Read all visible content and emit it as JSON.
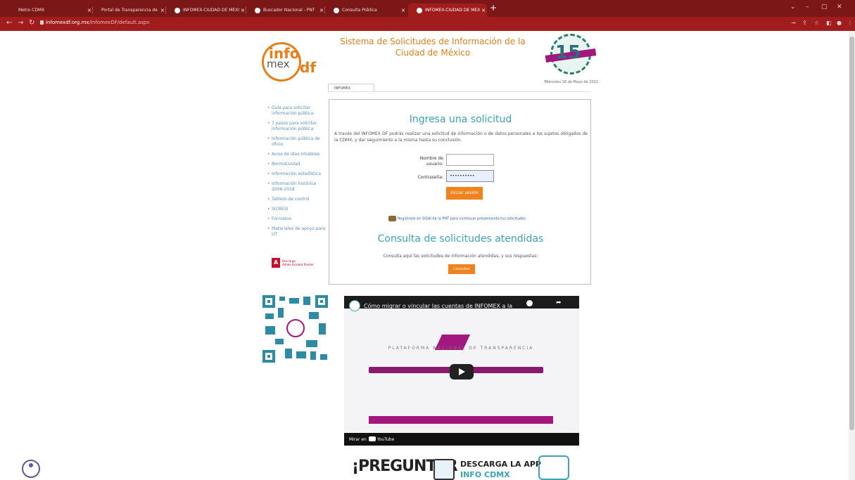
{
  "browser": {
    "tabs": [
      {
        "label": "Metro CDMX",
        "active": false
      },
      {
        "label": "Portal de Transparencia de la CDMX",
        "active": false
      },
      {
        "label": "INFOMEX-CIUDAD DE MÉXICO",
        "active": false
      },
      {
        "label": "Buscador Nacional - PNT",
        "active": false
      },
      {
        "label": "Consulta Pública",
        "active": false
      },
      {
        "label": "INFOMEX-CIUDAD DE MÉXICO",
        "active": true
      }
    ],
    "url_domain": "infomexdf.org.mx",
    "url_path": "/InfomexDF/default.aspx",
    "accent_color": "#a11c1c"
  },
  "header": {
    "logo_info": "info",
    "logo_mex": "mex",
    "logo_df": "df",
    "title": "Sistema de Solicitudes de Información de la Ciudad de México",
    "emblem_number": "15",
    "date": "Miércoles 18 de Mayo de 2022",
    "tab_label": "INFOMEX"
  },
  "sidebar": {
    "items": [
      "Guía para solicitar información pública",
      "7 pasos para solicitar información pública",
      "Información pública de oficio",
      "Aviso de días inhábiles",
      "Normatividad",
      "Información estadística",
      "Información histórica 2006-2018",
      "Tablero de control",
      "SICRESI",
      "Formatos",
      "Materiales de apoyo para UT"
    ],
    "acrobat_line1": "Descarga",
    "acrobat_line2": "Adobe Acrobat Reader"
  },
  "main": {
    "heading": "Ingresa una solicitud",
    "intro": "A través del INFOMEX DF podrás realizar una solicitud de información o de datos personales a los sujetos obligados de la CDMX, y dar seguimiento a la misma hasta su conclusión.",
    "username_label": "Nombre de usuario:",
    "username_value": "",
    "password_label": "Contraseña:",
    "password_value": "••••••••••",
    "login_button": "Iniciar sesión",
    "register_link": "Registrate en SISAI de la PNT para continuar presentando tus solicitudes",
    "consulta_heading": "Consulta de solicitudes atendidas",
    "consulta_text": "Consulta aquí las solicitudes de información atendidas, y sus respuestas:",
    "consulta_button": "Consultar",
    "accent_color": "#f0831e",
    "heading_color": "#3aa3b6"
  },
  "video": {
    "title": "Cómo migrar o vincular las cuentas de INFOMEX a la",
    "platform_text": "PLATAFORMA NACIONAL DE TRANSPARENCIA",
    "watch_on": "Mirar en",
    "youtube": "YouTube"
  },
  "banner": {
    "text1": "¡PREGUNTAR",
    "text2": "DESCARGA LA APP",
    "text3": "INFO CDMX"
  }
}
